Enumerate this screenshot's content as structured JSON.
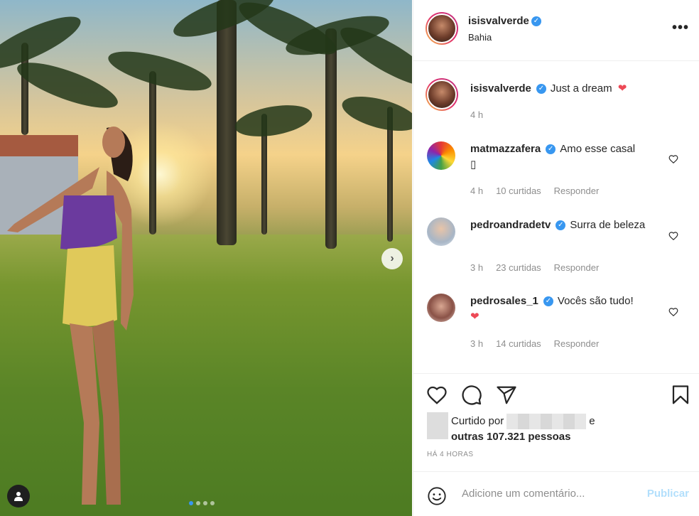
{
  "post": {
    "username": "isisvalverde",
    "verified": true,
    "location": "Bahia",
    "caption": "Just a dream",
    "caption_emoji": "❤",
    "caption_time": "4 h",
    "more_label": "•••"
  },
  "comments": [
    {
      "username": "matmazzafera",
      "text": "Amo esse casal",
      "emoji_box": "▯",
      "time": "4 h",
      "likes": "10 curtidas",
      "reply": "Responder"
    },
    {
      "username": "pedroandradetv",
      "text": "Surra de beleza",
      "time": "3 h",
      "likes": "23 curtidas",
      "reply": "Responder"
    },
    {
      "username": "pedrosales_1",
      "text": "Vocês são tudo!",
      "emoji": "❤",
      "time": "3 h",
      "likes": "14 curtidas",
      "reply": "Responder"
    }
  ],
  "likes": {
    "prefix": "Curtido por",
    "suffix": "e",
    "others": "outras 107.321 pessoas"
  },
  "timestamp": "HÁ 4 HORAS",
  "add_comment": {
    "placeholder": "Adicione um comentário...",
    "publish": "Publicar"
  },
  "carousel": {
    "next_glyph": "›",
    "slide_count": 4,
    "active_slide": 1
  },
  "colors": {
    "verified": "#3897f0",
    "heart": "#ed4956",
    "publish_disabled": "#b2dffc"
  },
  "icons": [
    "heart-icon",
    "comment-icon",
    "share-icon",
    "save-icon",
    "emoji-icon",
    "user-tag-icon",
    "more-icon",
    "chevron-right-icon"
  ]
}
